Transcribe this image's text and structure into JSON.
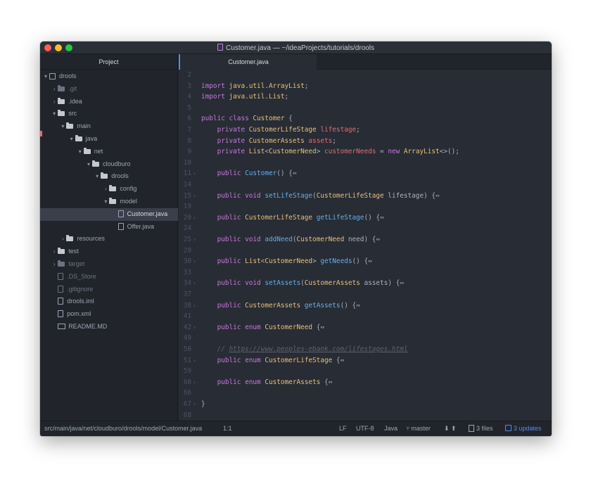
{
  "window": {
    "title": "Customer.java — ~/ideaProjects/tutorials/drools"
  },
  "sidebar": {
    "header": "Project",
    "tree": [
      {
        "label": "drools",
        "kind": "root",
        "arrow": "▾",
        "depth": 0
      },
      {
        "label": ".git",
        "kind": "folder",
        "arrow": "›",
        "depth": 1,
        "dim": true
      },
      {
        "label": ".idea",
        "kind": "folder",
        "arrow": "›",
        "depth": 1
      },
      {
        "label": "src",
        "kind": "folder",
        "arrow": "▾",
        "depth": 1
      },
      {
        "label": "main",
        "kind": "folder",
        "arrow": "▾",
        "depth": 2
      },
      {
        "label": "java",
        "kind": "folder",
        "arrow": "▾",
        "depth": 3
      },
      {
        "label": "net",
        "kind": "folder",
        "arrow": "▾",
        "depth": 4
      },
      {
        "label": "cloudburo",
        "kind": "folder",
        "arrow": "▾",
        "depth": 5
      },
      {
        "label": "drools",
        "kind": "folder",
        "arrow": "▾",
        "depth": 6
      },
      {
        "label": "config",
        "kind": "folder",
        "arrow": "›",
        "depth": 7
      },
      {
        "label": "model",
        "kind": "folder",
        "arrow": "▾",
        "depth": 7
      },
      {
        "label": "Customer.java",
        "kind": "file",
        "arrow": "",
        "depth": 8,
        "selected": true
      },
      {
        "label": "Offer.java",
        "kind": "file",
        "arrow": "",
        "depth": 8
      },
      {
        "label": "resources",
        "kind": "folder",
        "arrow": "›",
        "depth": 2
      },
      {
        "label": "test",
        "kind": "folder",
        "arrow": "›",
        "depth": 1
      },
      {
        "label": "target",
        "kind": "folder",
        "arrow": "›",
        "depth": 1,
        "dim": true
      },
      {
        "label": ".DS_Store",
        "kind": "file",
        "arrow": "",
        "depth": 1,
        "dim": true
      },
      {
        "label": ".gitignore",
        "kind": "file",
        "arrow": "",
        "depth": 1,
        "dim": true
      },
      {
        "label": "drools.iml",
        "kind": "file",
        "arrow": "",
        "depth": 1
      },
      {
        "label": "pom.xml",
        "kind": "file",
        "arrow": "",
        "depth": 1
      },
      {
        "label": "README.MD",
        "kind": "readme",
        "arrow": "",
        "depth": 1
      }
    ]
  },
  "editor": {
    "tab": "Customer.java",
    "lines": [
      {
        "n": "2",
        "fold": false,
        "tokens": []
      },
      {
        "n": "3",
        "fold": false,
        "tokens": [
          [
            "kw",
            "import "
          ],
          [
            "ty",
            "java.util.ArrayList"
          ],
          [
            "pl",
            ";"
          ]
        ]
      },
      {
        "n": "4",
        "fold": false,
        "tokens": [
          [
            "kw",
            "import "
          ],
          [
            "ty",
            "java.util.List"
          ],
          [
            "pl",
            ";"
          ]
        ]
      },
      {
        "n": "5",
        "fold": false,
        "tokens": []
      },
      {
        "n": "6",
        "fold": false,
        "tokens": [
          [
            "kw",
            "public class "
          ],
          [
            "ty",
            "Customer"
          ],
          [
            "pl",
            " {"
          ]
        ]
      },
      {
        "n": "7",
        "fold": false,
        "tokens": [
          [
            "pl",
            "    "
          ],
          [
            "kw",
            "private "
          ],
          [
            "ty",
            "CustomerLifeStage "
          ],
          [
            "va",
            "lifestage"
          ],
          [
            "pl",
            ";"
          ]
        ]
      },
      {
        "n": "8",
        "fold": false,
        "tokens": [
          [
            "pl",
            "    "
          ],
          [
            "kw",
            "private "
          ],
          [
            "ty",
            "CustomerAssets "
          ],
          [
            "va",
            "assets"
          ],
          [
            "pl",
            ";"
          ]
        ]
      },
      {
        "n": "9",
        "fold": false,
        "tokens": [
          [
            "pl",
            "    "
          ],
          [
            "kw",
            "private "
          ],
          [
            "ty",
            "List"
          ],
          [
            "pl",
            "<"
          ],
          [
            "ty",
            "CustomerNeed"
          ],
          [
            "pl",
            "> "
          ],
          [
            "va",
            "customerNeeds"
          ],
          [
            "pl",
            " = "
          ],
          [
            "kw",
            "new "
          ],
          [
            "ty",
            "ArrayList"
          ],
          [
            "pl",
            "<>();"
          ]
        ]
      },
      {
        "n": "10",
        "fold": false,
        "tokens": []
      },
      {
        "n": "11",
        "fold": true,
        "tokens": [
          [
            "pl",
            "    "
          ],
          [
            "kw",
            "public "
          ],
          [
            "fn",
            "Customer"
          ],
          [
            "pl",
            "() {⇔"
          ]
        ]
      },
      {
        "n": "14",
        "fold": false,
        "tokens": []
      },
      {
        "n": "15",
        "fold": true,
        "tokens": [
          [
            "pl",
            "    "
          ],
          [
            "kw",
            "public void "
          ],
          [
            "fn",
            "setLifeStage"
          ],
          [
            "pl",
            "("
          ],
          [
            "ty",
            "CustomerLifeStage"
          ],
          [
            "pl",
            " lifestage) {⇔"
          ]
        ]
      },
      {
        "n": "19",
        "fold": false,
        "tokens": []
      },
      {
        "n": "20",
        "fold": true,
        "tokens": [
          [
            "pl",
            "    "
          ],
          [
            "kw",
            "public "
          ],
          [
            "ty",
            "CustomerLifeStage "
          ],
          [
            "fn",
            "getLifeStage"
          ],
          [
            "pl",
            "() {⇔"
          ]
        ]
      },
      {
        "n": "24",
        "fold": false,
        "tokens": []
      },
      {
        "n": "25",
        "fold": true,
        "tokens": [
          [
            "pl",
            "    "
          ],
          [
            "kw",
            "public void "
          ],
          [
            "fn",
            "addNeed"
          ],
          [
            "pl",
            "("
          ],
          [
            "ty",
            "CustomerNeed"
          ],
          [
            "pl",
            " need) {⇔"
          ]
        ]
      },
      {
        "n": "29",
        "fold": false,
        "tokens": []
      },
      {
        "n": "30",
        "fold": true,
        "tokens": [
          [
            "pl",
            "    "
          ],
          [
            "kw",
            "public "
          ],
          [
            "ty",
            "List"
          ],
          [
            "pl",
            "<"
          ],
          [
            "ty",
            "CustomerNeed"
          ],
          [
            "pl",
            "> "
          ],
          [
            "fn",
            "getNeeds"
          ],
          [
            "pl",
            "() {⇔"
          ]
        ]
      },
      {
        "n": "33",
        "fold": false,
        "tokens": []
      },
      {
        "n": "34",
        "fold": true,
        "tokens": [
          [
            "pl",
            "    "
          ],
          [
            "kw",
            "public void "
          ],
          [
            "fn",
            "setAssets"
          ],
          [
            "pl",
            "("
          ],
          [
            "ty",
            "CustomerAssets"
          ],
          [
            "pl",
            " assets) {⇔"
          ]
        ]
      },
      {
        "n": "37",
        "fold": false,
        "tokens": []
      },
      {
        "n": "38",
        "fold": true,
        "tokens": [
          [
            "pl",
            "    "
          ],
          [
            "kw",
            "public "
          ],
          [
            "ty",
            "CustomerAssets "
          ],
          [
            "fn",
            "getAssets"
          ],
          [
            "pl",
            "() {⇔"
          ]
        ]
      },
      {
        "n": "41",
        "fold": false,
        "tokens": []
      },
      {
        "n": "42",
        "fold": true,
        "tokens": [
          [
            "pl",
            "    "
          ],
          [
            "kw",
            "public enum "
          ],
          [
            "ty",
            "CustomerNeed"
          ],
          [
            "pl",
            " {⇔"
          ]
        ]
      },
      {
        "n": "49",
        "fold": false,
        "tokens": []
      },
      {
        "n": "50",
        "fold": false,
        "tokens": [
          [
            "pl",
            "    "
          ],
          [
            "cm",
            "// "
          ],
          [
            "url",
            "https://www.peoples-ebank.com/lifestages.html"
          ]
        ]
      },
      {
        "n": "51",
        "fold": true,
        "tokens": [
          [
            "pl",
            "    "
          ],
          [
            "kw",
            "public enum "
          ],
          [
            "ty",
            "CustomerLifeStage"
          ],
          [
            "pl",
            " {⇔"
          ]
        ]
      },
      {
        "n": "59",
        "fold": false,
        "tokens": []
      },
      {
        "n": "60",
        "fold": true,
        "tokens": [
          [
            "pl",
            "    "
          ],
          [
            "kw",
            "public enum "
          ],
          [
            "ty",
            "CustomerAssets"
          ],
          [
            "pl",
            " {⇔"
          ]
        ]
      },
      {
        "n": "66",
        "fold": false,
        "tokens": []
      },
      {
        "n": "67",
        "fold": true,
        "tokens": [
          [
            "pl",
            "}"
          ]
        ]
      },
      {
        "n": "68",
        "fold": false,
        "tokens": []
      }
    ]
  },
  "statusbar": {
    "path": "src/main/java/net/cloudburo/drools/model/Customer.java",
    "cursor": "1:1",
    "line_ending": "LF",
    "encoding": "UTF-8",
    "grammar": "Java",
    "branch": "master",
    "fetch": "⬇ ⬆",
    "files": "3 files",
    "updates": "3 updates"
  }
}
